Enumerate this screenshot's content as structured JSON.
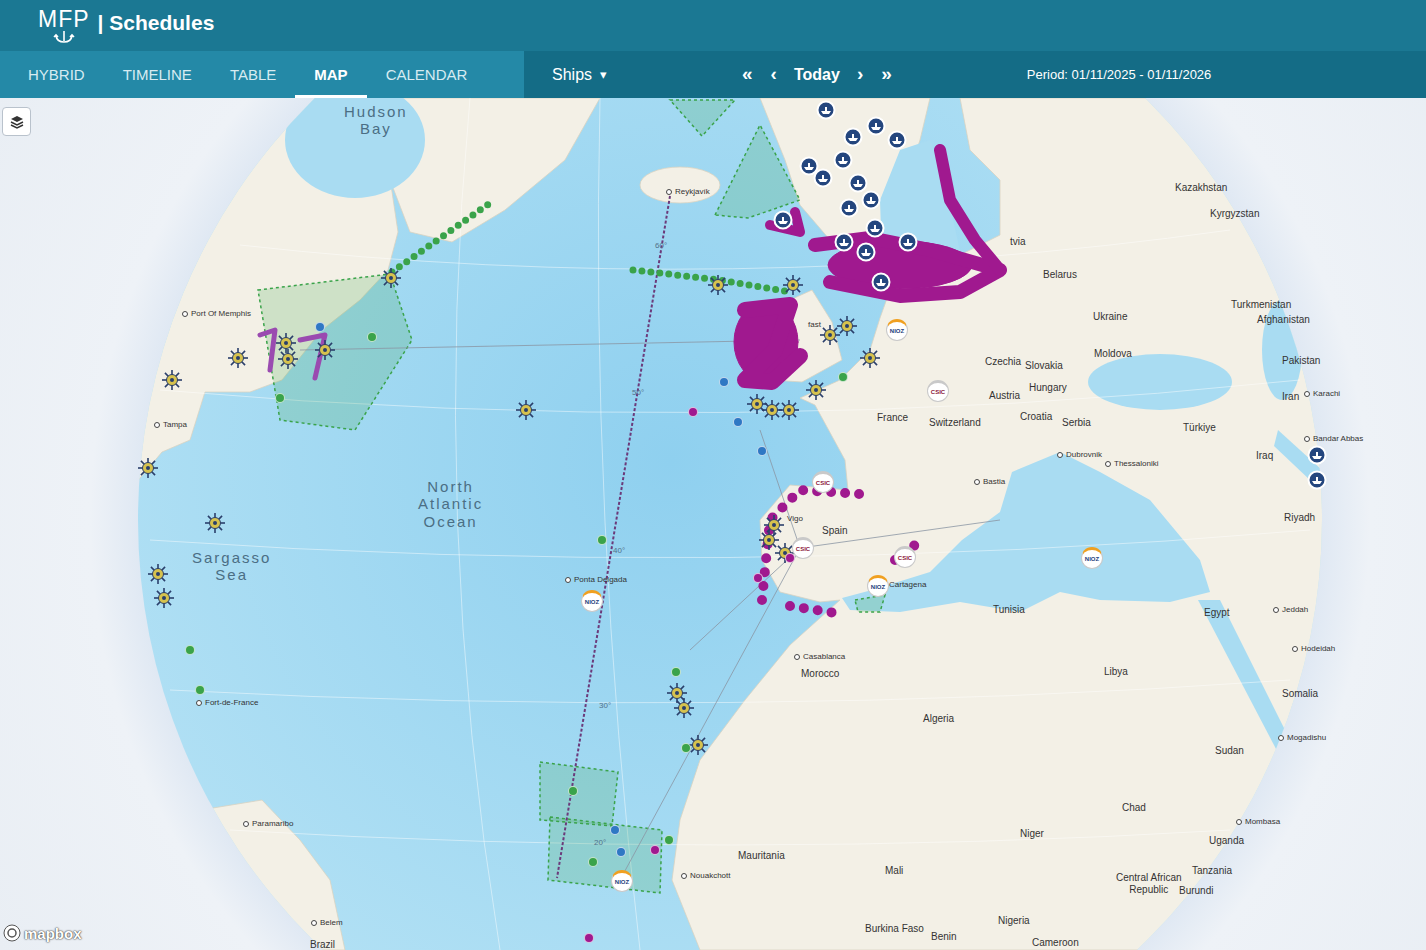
{
  "app": {
    "logo": "MFP",
    "title": "| Schedules"
  },
  "tabs": [
    {
      "label": "HYBRID",
      "selected": false
    },
    {
      "label": "TIMELINE",
      "selected": false
    },
    {
      "label": "TABLE",
      "selected": false
    },
    {
      "label": "MAP",
      "selected": true
    },
    {
      "label": "CALENDAR",
      "selected": false
    }
  ],
  "toolbar": {
    "filter": "Ships",
    "filter_icon": "▾",
    "nav": [
      "«",
      "‹",
      "Today",
      "›",
      "»"
    ],
    "period": "Period: 01/11/2025 - 01/11/2026"
  },
  "map": {
    "attribution": "mapbox",
    "places": [
      {
        "name": "Hudson\nBay",
        "kind": "sea"
      },
      {
        "name": "North\nAtlantic\nOcean",
        "kind": "sea"
      },
      {
        "name": "Sargasso\nSea",
        "kind": "sea"
      },
      {
        "name": "60°",
        "kind": "grid"
      },
      {
        "name": "50°",
        "kind": "grid"
      },
      {
        "name": "40°",
        "kind": "grid"
      },
      {
        "name": "30°",
        "kind": "grid"
      },
      {
        "name": "20°",
        "kind": "grid"
      },
      {
        "name": "Reykjavík",
        "kind": "city"
      },
      {
        "name": "Port Of Memphis",
        "kind": "city"
      },
      {
        "name": "Tampa",
        "kind": "city"
      },
      {
        "name": "Fort-de-France",
        "kind": "city"
      },
      {
        "name": "Paramaribo",
        "kind": "city"
      },
      {
        "name": "Belem",
        "kind": "city"
      },
      {
        "name": "Ponta Delgada",
        "kind": "city"
      },
      {
        "name": "Casablanca",
        "kind": "city"
      },
      {
        "name": "Nouakchott",
        "kind": "city"
      },
      {
        "name": "Bastia",
        "kind": "city"
      },
      {
        "name": "Dubrovnik",
        "kind": "city"
      },
      {
        "name": "Thessaloniki",
        "kind": "city"
      },
      {
        "name": "Bandar Abbas",
        "kind": "city"
      },
      {
        "name": "Karachi",
        "kind": "city"
      },
      {
        "name": "Jeddah",
        "kind": "city"
      },
      {
        "name": "Hodeidah",
        "kind": "city"
      },
      {
        "name": "Mogadishu",
        "kind": "city"
      },
      {
        "name": "Mombasa",
        "kind": "city"
      },
      {
        "name": "Vigo",
        "kind": "town"
      },
      {
        "name": "Cartagena",
        "kind": "town"
      },
      {
        "name": "fast",
        "kind": "town"
      },
      {
        "name": "Kazakhstan",
        "kind": "country"
      },
      {
        "name": "Kyrgyzstan",
        "kind": "country"
      },
      {
        "name": "Belarus",
        "kind": "country"
      },
      {
        "name": "Ukraine",
        "kind": "country"
      },
      {
        "name": "Turkmenistan",
        "kind": "country"
      },
      {
        "name": "Afghanistan",
        "kind": "country"
      },
      {
        "name": "Moldova",
        "kind": "country"
      },
      {
        "name": "Pakistan",
        "kind": "country"
      },
      {
        "name": "Iran",
        "kind": "country"
      },
      {
        "name": "Czechia",
        "kind": "country"
      },
      {
        "name": "Slovakia",
        "kind": "country"
      },
      {
        "name": "Hungary",
        "kind": "country"
      },
      {
        "name": "Austria",
        "kind": "country"
      },
      {
        "name": "France",
        "kind": "country"
      },
      {
        "name": "Switzerland",
        "kind": "country"
      },
      {
        "name": "Croatia",
        "kind": "country"
      },
      {
        "name": "Serbia",
        "kind": "country"
      },
      {
        "name": "Türkiye",
        "kind": "country"
      },
      {
        "name": "Iraq",
        "kind": "country"
      },
      {
        "name": "Riyadh",
        "kind": "country"
      },
      {
        "name": "Spain",
        "kind": "country"
      },
      {
        "name": "Morocco",
        "kind": "country"
      },
      {
        "name": "Tunisia",
        "kind": "country"
      },
      {
        "name": "Egypt",
        "kind": "country"
      },
      {
        "name": "Libya",
        "kind": "country"
      },
      {
        "name": "Algeria",
        "kind": "country"
      },
      {
        "name": "Somalia",
        "kind": "country"
      },
      {
        "name": "Sudan",
        "kind": "country"
      },
      {
        "name": "Mauritania",
        "kind": "country"
      },
      {
        "name": "Chad",
        "kind": "country"
      },
      {
        "name": "Niger",
        "kind": "country"
      },
      {
        "name": "Mali",
        "kind": "country"
      },
      {
        "name": "Uganda",
        "kind": "country"
      },
      {
        "name": "Tanzania",
        "kind": "country"
      },
      {
        "name": "Central African\nRepublic",
        "kind": "country"
      },
      {
        "name": "Burundi",
        "kind": "country"
      },
      {
        "name": "Burkina Faso",
        "kind": "country"
      },
      {
        "name": "Benin",
        "kind": "country"
      },
      {
        "name": "Nigeria",
        "kind": "country"
      },
      {
        "name": "Cameroon",
        "kind": "country"
      },
      {
        "name": "Brazil",
        "kind": "country"
      },
      {
        "name": "tvia",
        "kind": "country"
      }
    ],
    "markers": [
      {
        "kind": "vessel"
      },
      {
        "kind": "vessel"
      },
      {
        "kind": "vessel"
      },
      {
        "kind": "vessel"
      },
      {
        "kind": "vessel"
      },
      {
        "kind": "vessel"
      },
      {
        "kind": "vessel"
      },
      {
        "kind": "vessel"
      },
      {
        "kind": "vessel"
      },
      {
        "kind": "vessel"
      },
      {
        "kind": "vessel"
      },
      {
        "kind": "vessel"
      },
      {
        "kind": "vessel"
      },
      {
        "kind": "vessel"
      },
      {
        "kind": "vessel"
      },
      {
        "kind": "vessel"
      },
      {
        "kind": "vessel"
      },
      {
        "kind": "vessel"
      },
      {
        "kind": "vessel"
      },
      {
        "kind": "vessel"
      },
      {
        "kind": "vessel"
      },
      {
        "kind": "vessel"
      },
      {
        "kind": "vessel"
      },
      {
        "kind": "vessel"
      },
      {
        "kind": "vessel"
      },
      {
        "kind": "vessel"
      },
      {
        "kind": "navy"
      },
      {
        "kind": "navy"
      },
      {
        "kind": "navy"
      },
      {
        "kind": "navy"
      },
      {
        "kind": "navy"
      },
      {
        "kind": "navy"
      },
      {
        "kind": "navy"
      },
      {
        "kind": "navy"
      },
      {
        "kind": "navy"
      },
      {
        "kind": "navy"
      },
      {
        "kind": "navy"
      },
      {
        "kind": "navy"
      },
      {
        "kind": "navy"
      },
      {
        "kind": "navy"
      },
      {
        "kind": "navy"
      },
      {
        "kind": "navy"
      },
      {
        "kind": "navy"
      },
      {
        "kind": "navy"
      },
      {
        "kind": "dot",
        "color": "#3aa34a"
      },
      {
        "kind": "dot",
        "color": "#3aa34a"
      },
      {
        "kind": "dot",
        "color": "#3aa34a"
      },
      {
        "kind": "dot",
        "color": "#3aa34a"
      },
      {
        "kind": "dot",
        "color": "#3aa34a"
      },
      {
        "kind": "dot",
        "color": "#3aa34a"
      },
      {
        "kind": "dot",
        "color": "#3aa34a"
      },
      {
        "kind": "dot",
        "color": "#3aa34a"
      },
      {
        "kind": "dot",
        "color": "#3aa34a"
      },
      {
        "kind": "dot",
        "color": "#3aa34a"
      },
      {
        "kind": "dot",
        "color": "#3aa34a"
      },
      {
        "kind": "dot",
        "color": "#2f78c4"
      },
      {
        "kind": "dot",
        "color": "#2f78c4"
      },
      {
        "kind": "dot",
        "color": "#2f78c4"
      },
      {
        "kind": "dot",
        "color": "#2f78c4"
      },
      {
        "kind": "dot",
        "color": "#2f78c4"
      },
      {
        "kind": "dot",
        "color": "#2f78c4"
      },
      {
        "kind": "dot",
        "color": "#a0198f"
      },
      {
        "kind": "dot",
        "color": "#a0198f"
      },
      {
        "kind": "dot",
        "color": "#a0198f"
      },
      {
        "kind": "dot",
        "color": "#a0198f"
      },
      {
        "kind": "dot",
        "color": "#a0198f"
      },
      {
        "kind": "csic",
        "label": "CSIC"
      },
      {
        "kind": "csic",
        "label": "CSIC"
      },
      {
        "kind": "csic",
        "label": "CSIC"
      },
      {
        "kind": "csic",
        "label": "CSIC"
      },
      {
        "kind": "nioz",
        "label": "NIOZ"
      },
      {
        "kind": "nioz",
        "label": "NIOZ"
      },
      {
        "kind": "nioz",
        "label": "NIOZ"
      },
      {
        "kind": "nioz",
        "label": "NIOZ"
      },
      {
        "kind": "nioz",
        "label": "NIOZ"
      }
    ]
  }
}
